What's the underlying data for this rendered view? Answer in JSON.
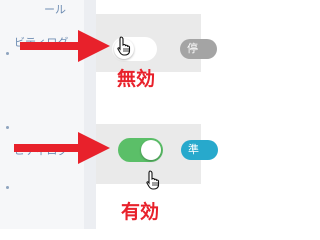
{
  "sidebar": {
    "items": [
      {
        "label": "ール"
      },
      {
        "label": "ビティログ"
      },
      {
        "label": "ビティログ"
      }
    ]
  },
  "rows": [
    {
      "toggle_state": "off",
      "status_label": "無効",
      "badge_label": "停"
    },
    {
      "toggle_state": "on",
      "status_label": "有効",
      "badge_label": "準"
    }
  ],
  "colors": {
    "annotation_red": "#e8212b",
    "toggle_on": "#5bbf68",
    "toggle_off": "#ffffff",
    "badge_off": "#a4a4a4",
    "badge_on": "#27a9cc",
    "panel_bg": "#eaeaea",
    "sidebar_text": "#6f8db3"
  },
  "icons": [
    "arrow-right-icon",
    "hand-pointer-icon"
  ]
}
